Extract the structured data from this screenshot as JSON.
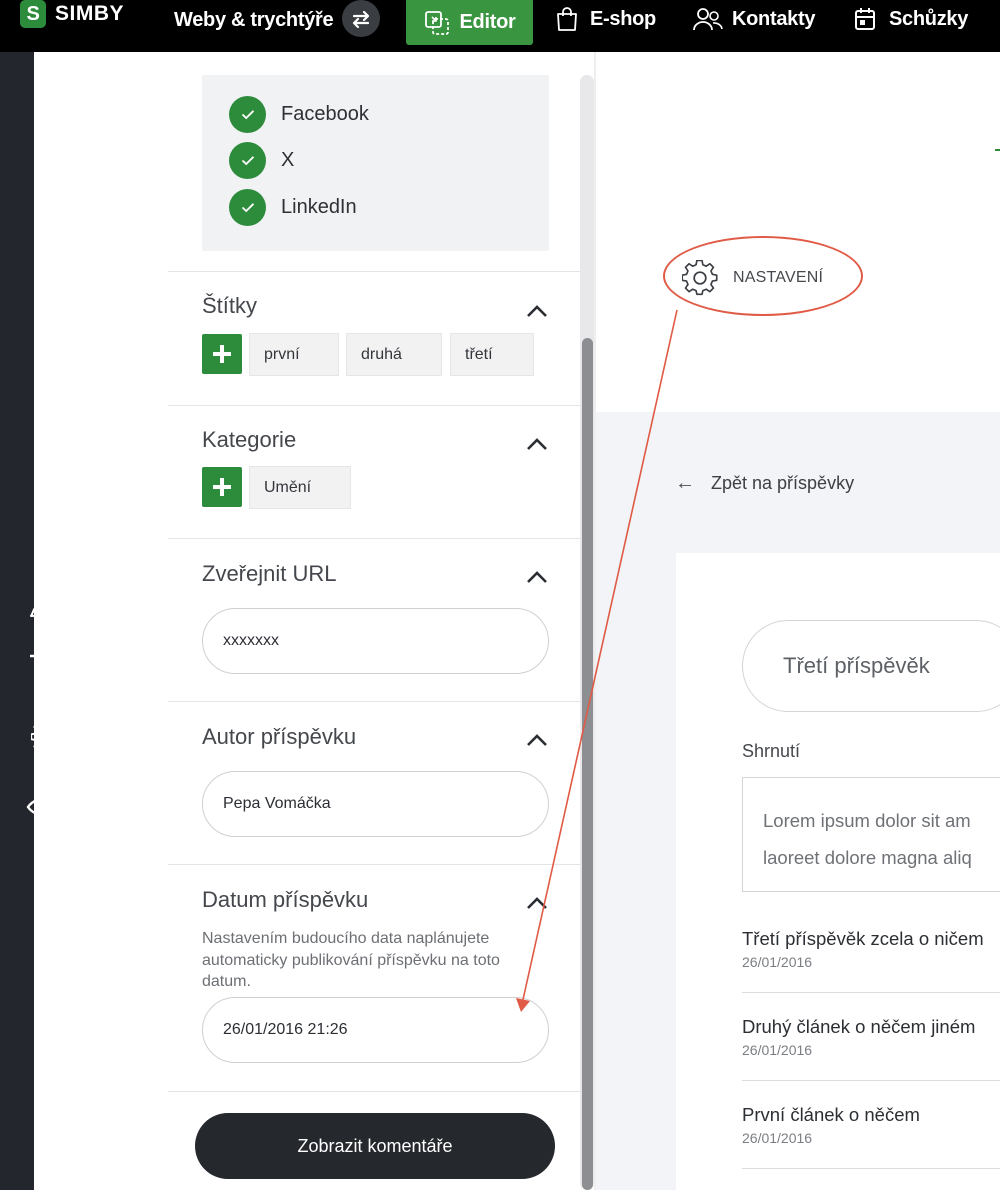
{
  "topbar": {
    "logo_letter": "S",
    "brand": "SIMBY",
    "nav": {
      "weby": "Weby & trychtýře",
      "editor": "Editor",
      "eshop": "E-shop",
      "kontakty": "Kontakty",
      "schuzky": "Schůzky"
    }
  },
  "toolbar": {
    "icons": [
      "menu-icon",
      "plus-icon",
      "brush-icon",
      "filter-icon",
      "gear-icon",
      "eye-icon"
    ]
  },
  "panel": {
    "social": [
      "Facebook",
      "X",
      "LinkedIn"
    ],
    "tags": {
      "title": "Štítky",
      "items": [
        "první",
        "druhá",
        "třetí"
      ]
    },
    "categories": {
      "title": "Kategorie",
      "items": [
        "Umění"
      ]
    },
    "url": {
      "title": "Zveřejnit URL",
      "value": "xxxxxxx"
    },
    "author": {
      "title": "Autor příspěvku",
      "value": "Pepa Vomáčka"
    },
    "date": {
      "title": "Datum příspěvku",
      "helper": "Nastavením budoucího data naplánujete automaticky publikování příspěvku na toto datum.",
      "value": "26/01/2016 21:26"
    },
    "comments_button": "Zobrazit komentáře"
  },
  "preview": {
    "settings_label": "NASTAVENÍ",
    "back_link": "Zpět na příspěvky",
    "post_title_value": "Třetí příspěvěk",
    "summary_label": "Shrnutí",
    "summary_line1": "Lorem ipsum dolor sit am",
    "summary_line2": "laoreet dolore magna aliq",
    "posts": [
      {
        "title": "Třetí příspěvěk zcela o ničem",
        "date": "26/01/2016"
      },
      {
        "title": "Druhý článek o něčem jiném",
        "date": "26/01/2016"
      },
      {
        "title": "První článek o něčem",
        "date": "26/01/2016"
      }
    ]
  },
  "colors": {
    "accent_green": "#2d8c3c",
    "editor_green": "#3a9540",
    "annotation_red": "#e05a45",
    "dark": "#23262c"
  }
}
